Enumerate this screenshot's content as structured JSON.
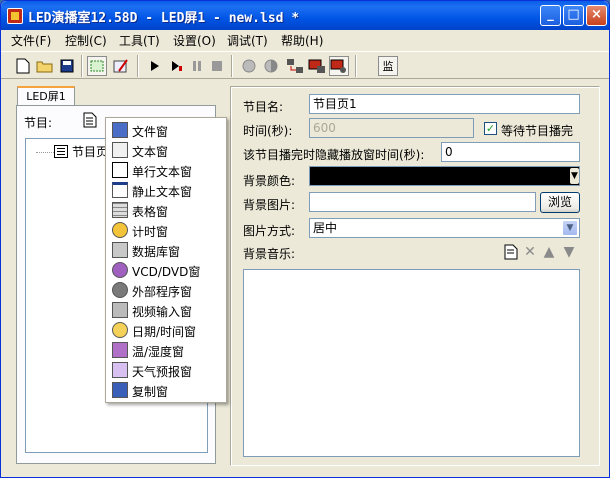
{
  "window": {
    "title": "LED演播室12.58D - LED屏1 - new.lsd *",
    "controls": [
      "_",
      "□",
      "×"
    ]
  },
  "menu": [
    "文件(F)",
    "控制(C)",
    "工具(T)",
    "设置(O)",
    "调试(T)",
    "帮助(H)"
  ],
  "toolbar": {
    "monitor_label": "监"
  },
  "left": {
    "tab_label": "LED屏1",
    "program_label": "节目:",
    "tree_item": "节目页1"
  },
  "context_menu": [
    {
      "label": "文件窗",
      "icon": "file-window-icon"
    },
    {
      "label": "文本窗",
      "icon": "text-window-icon"
    },
    {
      "label": "单行文本窗",
      "icon": "single-line-text-icon"
    },
    {
      "label": "静止文本窗",
      "icon": "static-text-icon"
    },
    {
      "label": "表格窗",
      "icon": "table-window-icon"
    },
    {
      "label": "计时窗",
      "icon": "timer-window-icon"
    },
    {
      "label": "数据库窗",
      "icon": "database-window-icon"
    },
    {
      "label": "VCD/DVD窗",
      "icon": "vcd-dvd-icon"
    },
    {
      "label": "外部程序窗",
      "icon": "external-program-icon"
    },
    {
      "label": "视频输入窗",
      "icon": "video-input-icon"
    },
    {
      "label": "日期/时间窗",
      "icon": "clock-icon"
    },
    {
      "label": "温/湿度窗",
      "icon": "temperature-humidity-icon"
    },
    {
      "label": "天气预报窗",
      "icon": "weather-icon"
    },
    {
      "label": "复制窗",
      "icon": "copy-window-icon"
    }
  ],
  "props": {
    "name_label": "节目名:",
    "name_value": "节目页1",
    "time_label": "时间(秒):",
    "time_value": "600",
    "wait_label": "等待节目播完",
    "wait_checked": true,
    "hide_label": "该节目播完时隐藏播放窗时间(秒):",
    "hide_value": "0",
    "bgcolor_label": "背景颜色:",
    "bgcolor_value": "#000000",
    "bgimage_label": "背景图片:",
    "bgimage_value": "",
    "browse_label": "浏览",
    "imagemode_label": "图片方式:",
    "imagemode_value": "居中",
    "music_label": "背景音乐:"
  }
}
